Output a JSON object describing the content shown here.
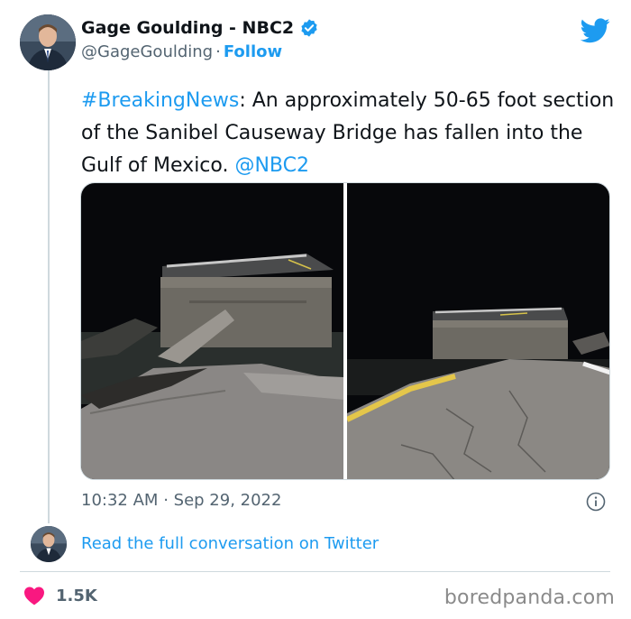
{
  "author": {
    "display_name": "Gage Goulding - NBC2",
    "handle": "@GageGoulding",
    "separator": "·",
    "follow_label": "Follow",
    "verified_icon": "verified-badge-icon"
  },
  "tweet": {
    "hashtag": "#BreakingNews",
    "body": ": An approximately 50-65 foot section of the Sanibel Causeway Bridge has fallen into the Gulf of Mexico. ",
    "mention": "@NBC2"
  },
  "meta": {
    "time": "10:32 AM",
    "separator": "·",
    "date": "Sep 29, 2022"
  },
  "conversation_link": "Read the full conversation on Twitter",
  "likes": {
    "count": "1.5K",
    "icon": "heart-icon"
  },
  "watermark": "boredpanda.com",
  "colors": {
    "link": "#1d9bf0",
    "secondary_text": "#536471",
    "heart": "#f91880",
    "twitter_bird": "#1d9bf0"
  }
}
